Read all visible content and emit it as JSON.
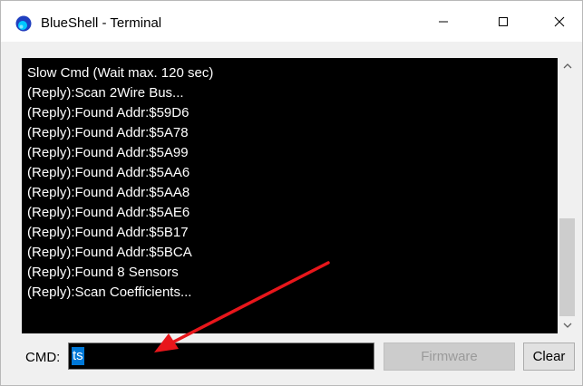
{
  "window": {
    "title": "BlueShell - Terminal",
    "icon": "blueshell-app-icon"
  },
  "terminal": {
    "lines": [
      "Slow Cmd (Wait max. 120 sec)",
      "(Reply):Scan 2Wire Bus...",
      "(Reply):Found Addr:$59D6",
      "(Reply):Found Addr:$5A78",
      "(Reply):Found Addr:$5A99",
      "(Reply):Found Addr:$5AA6",
      "(Reply):Found Addr:$5AA8",
      "(Reply):Found Addr:$5AE6",
      "(Reply):Found Addr:$5B17",
      "(Reply):Found Addr:$5BCA",
      "(Reply):Found 8 Sensors",
      "(Reply):Scan Coefficients..."
    ]
  },
  "command": {
    "label": "CMD:",
    "value": "ts"
  },
  "buttons": {
    "firmware": "Firmware",
    "clear": "Clear"
  },
  "colors": {
    "terminal_background": "#000000",
    "terminal_text": "#ffffff",
    "selection": "#0078d7",
    "annotation_arrow": "#e8161b"
  }
}
